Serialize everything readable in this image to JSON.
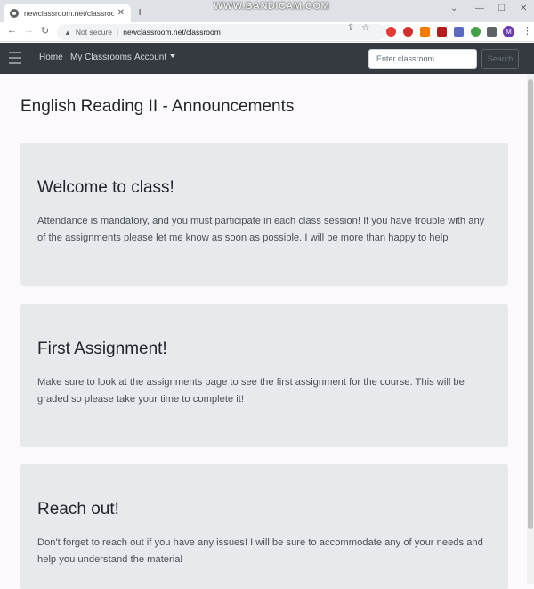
{
  "browser": {
    "tab_title": "newclassroom.net/classroom",
    "new_tab": "+",
    "watermark": "WWW.BANDICAM.COM",
    "not_secure": "Not secure",
    "url": "newclassroom.net/classroom",
    "profile_initial": "M"
  },
  "navbar": {
    "links": [
      "Home",
      "My Classrooms",
      "Account"
    ],
    "search_placeholder": "Enter classroom...",
    "search_button": "Search"
  },
  "page": {
    "title": "English Reading II - Announcements"
  },
  "announcements": [
    {
      "title": "Welcome to class!",
      "body": "Attendance is mandatory, and you must participate in each class session! If you have trouble with any of the assignments please let me know as soon as possible. I will be more than happy to help"
    },
    {
      "title": "First Assignment!",
      "body": "Make sure to look at the assignments page to see the first assignment for the course. This will be graded so please take your time to complete it!"
    },
    {
      "title": "Reach out!",
      "body": "Don't forget to reach out if you have any issues! I will be sure to accommodate any of your needs and help you understand the material"
    }
  ]
}
